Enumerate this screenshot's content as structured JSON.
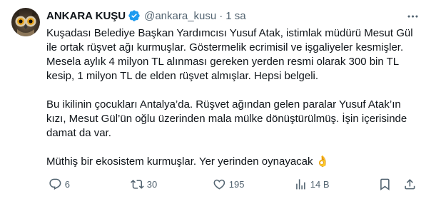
{
  "tweet": {
    "author_name": "ANKARA KUŞU",
    "handle": "@ankara_kusu",
    "separator": "·",
    "time": "1 sa",
    "paragraphs": [
      "Kuşadası Belediye Başkan Yardımcısı Yusuf Atak, istimlak müdürü Mesut Gül ile ortak rüşvet ağı kurmuşlar. Göstermelik ecrimisil ve işgaliyeler kesmişler. Mesela aylık 4 milyon TL alınması gereken yerden resmi olarak 300 bin TL kesip, 1 milyon TL de elden rüşvet almışlar. Hepsi belgeli.",
      "Bu ikilinin çocukları Antalya’da. Rüşvet ağından gelen paralar Yusuf Atak’ın kızı, Mesut Gül’ün oğlu üzerinden mala mülke dönüştürülmüş. İşin içerisinde damat da var.",
      "Müthiş bir ekosistem kurmuşlar. Yer yerinden oynayacak 👌"
    ]
  },
  "actions": {
    "replies": "6",
    "retweets": "30",
    "likes": "195",
    "views": "14 B"
  },
  "icons": {
    "verified": "verified-badge-icon",
    "more": "more-icon",
    "reply": "reply-icon",
    "retweet": "retweet-icon",
    "like": "heart-icon",
    "views": "views-chart-icon",
    "bookmark": "bookmark-icon",
    "share": "share-icon"
  },
  "colors": {
    "verified": "#1d9bf0",
    "text": "#0f1419",
    "secondary": "#536471"
  }
}
